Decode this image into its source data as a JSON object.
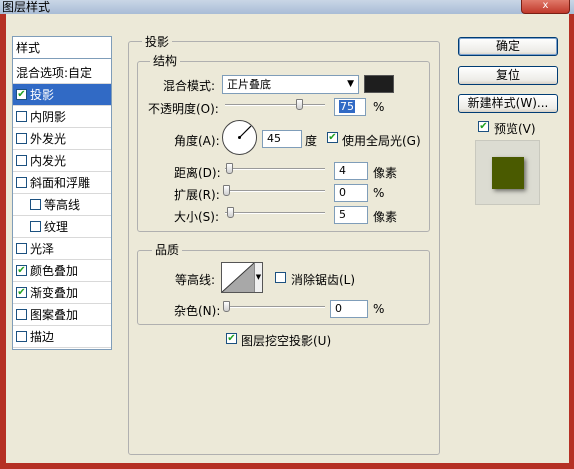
{
  "window": {
    "title": "图层样式",
    "close_glyph": "x"
  },
  "styles": {
    "header": "样式",
    "blend_options": "混合选项:自定",
    "items": [
      {
        "label": "投影",
        "checked": true,
        "selected": true,
        "indent": false
      },
      {
        "label": "内阴影",
        "checked": false,
        "indent": false
      },
      {
        "label": "外发光",
        "checked": false,
        "indent": false
      },
      {
        "label": "内发光",
        "checked": false,
        "indent": false
      },
      {
        "label": "斜面和浮雕",
        "checked": false,
        "indent": false
      },
      {
        "label": "等高线",
        "checked": false,
        "indent": true
      },
      {
        "label": "纹理",
        "checked": false,
        "indent": true
      },
      {
        "label": "光泽",
        "checked": false,
        "indent": false
      },
      {
        "label": "颜色叠加",
        "checked": true,
        "indent": false
      },
      {
        "label": "渐变叠加",
        "checked": true,
        "indent": false
      },
      {
        "label": "图案叠加",
        "checked": false,
        "indent": false
      },
      {
        "label": "描边",
        "checked": false,
        "indent": false
      }
    ]
  },
  "shadow": {
    "section_title": "投影",
    "structure": {
      "title": "结构",
      "blend_mode_label": "混合模式:",
      "blend_mode_value": "正片叠底",
      "shadow_color": "#1e1e1e",
      "opacity_label": "不透明度(O):",
      "opacity_value": "75",
      "opacity_unit": "%",
      "opacity_level": 0.75,
      "angle_label": "角度(A):",
      "angle_value": "45",
      "angle_unit": "度",
      "use_global_light_label": "使用全局光(G)",
      "use_global_light": true,
      "distance_label": "距离(D):",
      "distance_value": "4",
      "distance_unit": "像素",
      "spread_label": "扩展(R):",
      "spread_value": "0",
      "spread_unit": "%",
      "size_label": "大小(S):",
      "size_value": "5",
      "size_unit": "像素"
    },
    "quality": {
      "title": "品质",
      "contour_label": "等高线:",
      "antialias_label": "消除锯齿(L)",
      "antialias": false,
      "noise_label": "杂色(N):",
      "noise_value": "0",
      "noise_unit": "%"
    },
    "knockout_label": "图层挖空投影(U)",
    "knockout": true
  },
  "buttons": {
    "ok": "确定",
    "reset": "复位",
    "new_style": "新建样式(W)..."
  },
  "preview": {
    "label": "预览(V)",
    "checked": true,
    "swatch_color": "#4a5a00"
  },
  "colors": {
    "accent": "#316ac5",
    "frame": "#b53024"
  }
}
